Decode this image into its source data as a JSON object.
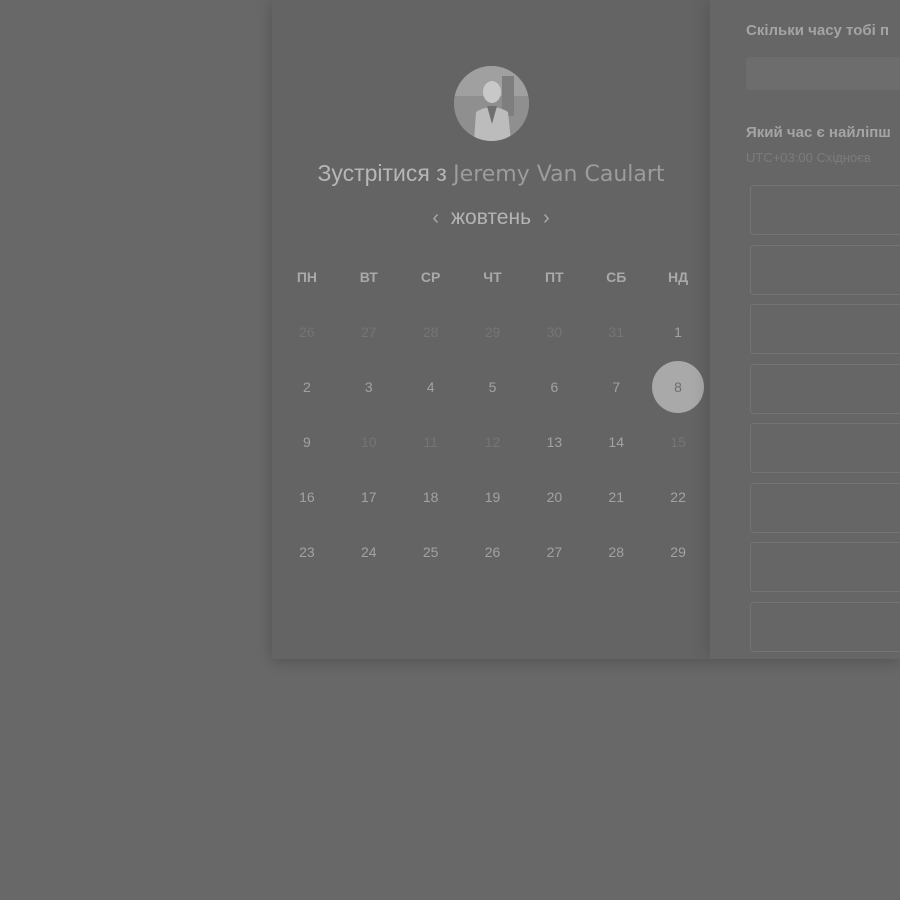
{
  "meeting": {
    "prefix": "Зустрітися з",
    "host": "Jeremy Van Caulart"
  },
  "calendar": {
    "month": "жовтень",
    "prev_icon": "chevron-left-icon",
    "next_icon": "chevron-right-icon",
    "weekdays": [
      "ПН",
      "ВТ",
      "СР",
      "ЧТ",
      "ПТ",
      "СБ",
      "НД"
    ],
    "weeks": [
      [
        "26",
        "27",
        "28",
        "29",
        "30",
        "31",
        "1"
      ],
      [
        "2",
        "3",
        "4",
        "5",
        "6",
        "7",
        "8"
      ],
      [
        "9",
        "10",
        "11",
        "12",
        "13",
        "14",
        "15"
      ],
      [
        "16",
        "17",
        "18",
        "19",
        "20",
        "21",
        "22"
      ],
      [
        "23",
        "24",
        "25",
        "26",
        "27",
        "28",
        "29"
      ]
    ],
    "selected": "8"
  },
  "booking": {
    "duration_label": "Скільки часу тобі п",
    "time_label": "Який час є найліпш",
    "timezone": "UTC+03:00 Східноєв"
  }
}
